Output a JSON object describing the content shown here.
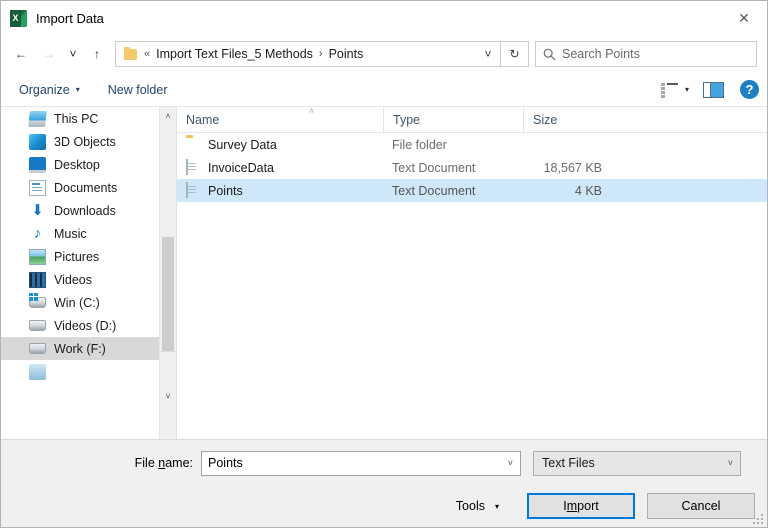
{
  "window": {
    "title": "Import Data",
    "app_icon": "excel-icon",
    "close_label": "✕"
  },
  "nav": {
    "back_icon": "←",
    "forward_icon": "→",
    "recent_icon": "˅",
    "up_icon": "↑",
    "breadcrumb_prefix": "«",
    "breadcrumb": [
      "Import Text Files_5 Methods",
      "Points"
    ],
    "breadcrumb_separator": "›",
    "dropdown_icon": "˅",
    "refresh_icon": "↻"
  },
  "search": {
    "placeholder": "Search Points",
    "icon": "search-icon"
  },
  "toolbar": {
    "organize_label": "Organize",
    "organize_caret": "▾",
    "new_folder_label": "New folder",
    "view_caret": "▾",
    "help_label": "?"
  },
  "sidebar": {
    "items": [
      {
        "label": "This PC",
        "icon": "pc-icon",
        "selected": false
      },
      {
        "label": "3D Objects",
        "icon": "3d-objects-icon",
        "selected": false
      },
      {
        "label": "Desktop",
        "icon": "desktop-icon",
        "selected": false
      },
      {
        "label": "Documents",
        "icon": "documents-icon",
        "selected": false
      },
      {
        "label": "Downloads",
        "icon": "downloads-icon",
        "selected": false
      },
      {
        "label": "Music",
        "icon": "music-icon",
        "selected": false
      },
      {
        "label": "Pictures",
        "icon": "pictures-icon",
        "selected": false
      },
      {
        "label": "Videos",
        "icon": "videos-icon",
        "selected": false
      },
      {
        "label": "Win (C:)",
        "icon": "drive-icon",
        "selected": false
      },
      {
        "label": "Videos (D:)",
        "icon": "drive-icon",
        "selected": false
      },
      {
        "label": "Work (F:)",
        "icon": "drive-icon",
        "selected": true
      }
    ],
    "scroll_up_icon": "˄",
    "scroll_down_icon": "˅",
    "download_glyph": "⬇",
    "music_glyph": "♪"
  },
  "filelist": {
    "columns": [
      "Name",
      "Type",
      "Size"
    ],
    "sort_caret": "˄",
    "rows": [
      {
        "name": "Survey Data",
        "type": "File folder",
        "size": "",
        "icon": "folder-icon",
        "selected": false
      },
      {
        "name": "InvoiceData",
        "type": "Text Document",
        "size": "18,567 KB",
        "icon": "text-document-icon",
        "selected": false
      },
      {
        "name": "Points",
        "type": "Text Document",
        "size": "4 KB",
        "icon": "text-document-icon",
        "selected": true
      }
    ]
  },
  "footer": {
    "filename_label_pre": "File ",
    "filename_label_accel": "n",
    "filename_label_post": "ame:",
    "filename_value": "Points",
    "filetype_value": "Text Files",
    "combo_caret": "˅",
    "tools_label": "Tools",
    "tools_caret": "▾",
    "import_pre": "I",
    "import_accel": "m",
    "import_post": "port",
    "cancel_label": "Cancel"
  },
  "colors": {
    "accent": "#0078d7",
    "selection": "#cfe8f9",
    "link": "#21436e",
    "excel_green": "#217346"
  }
}
